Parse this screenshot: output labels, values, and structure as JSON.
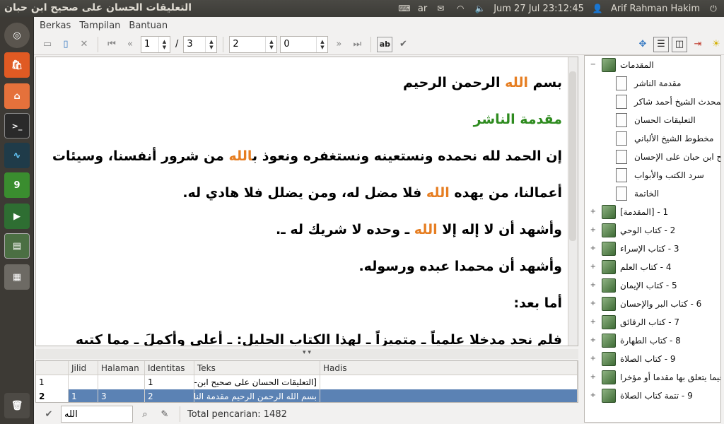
{
  "window_title": "التعليقات الحسان على صحيح ابن حبان",
  "tray": {
    "keyboard": "ar",
    "datetime": "Jum 27 Jul 23:12:45",
    "user": "Arif Rahman Hakim"
  },
  "menu": [
    "Berkas",
    "Tampilan",
    "Bantuan"
  ],
  "toolbar": {
    "volume": "1",
    "volume_total": "3",
    "page": "2",
    "offset": "0"
  },
  "text_lines": [
    {
      "parts": [
        {
          "t": "بسم ",
          "c": ""
        },
        {
          "t": "الله",
          "c": "orange"
        },
        {
          "t": " الرحمن الرحيم",
          "c": ""
        }
      ]
    },
    {
      "parts": [
        {
          "t": "مقدمة الناشر",
          "c": "green"
        }
      ]
    },
    {
      "parts": [
        {
          "t": "إن الحمد لله نحمده ونستعينه ونستغفره ونعوذ ب",
          "c": ""
        },
        {
          "t": "الله",
          "c": "orange"
        },
        {
          "t": " من شرور أنفسنا، وسيئات",
          "c": ""
        }
      ]
    },
    {
      "parts": [
        {
          "t": "أعمالنا، من يهده ",
          "c": ""
        },
        {
          "t": "الله",
          "c": "orange"
        },
        {
          "t": " فلا مضل له، ومن يضلل فلا هادي له.",
          "c": ""
        }
      ]
    },
    {
      "parts": [
        {
          "t": "وأشهد أن لا إله إلا ",
          "c": ""
        },
        {
          "t": "الله",
          "c": "orange"
        },
        {
          "t": " ـ وحده لا شريك له ـ.",
          "c": ""
        }
      ]
    },
    {
      "parts": [
        {
          "t": "وأشهد أن محمدا عبده ورسوله.",
          "c": ""
        }
      ]
    },
    {
      "parts": [
        {
          "t": "أما بعد:",
          "c": ""
        }
      ]
    },
    {
      "parts": [
        {
          "t": "فلم نجد مدخلا علمياً ـ متميزاً ـ لهذا الكتاب الجليل: ـ أعلى وأكملَ ـ مما كتبه",
          "c": ""
        }
      ]
    }
  ],
  "results": {
    "headers": [
      "",
      "Jilid",
      "Halaman",
      "Identitas",
      "Teks",
      "Hadis"
    ],
    "rows": [
      [
        "1",
        "",
        "",
        "1",
        "[التعليقات الحسان على صحيح ابن-",
        ""
      ],
      [
        "2",
        "1",
        "3",
        "2",
        "بسم الله الرحمن الرحيم مقدمة النا",
        ""
      ]
    ]
  },
  "search": {
    "value": "الله",
    "total_label": "Total pencarian: 1482"
  },
  "tree": [
    {
      "label": "المقدمات",
      "type": "book",
      "level": 0,
      "expander": "−"
    },
    {
      "label": "مقدمة الناشر",
      "type": "page",
      "level": 1
    },
    {
      "label": "ترجمة العلامة المحدث الشيخ أحمد شاكر",
      "type": "page",
      "level": 1
    },
    {
      "label": "التعليقات الحسان",
      "type": "page",
      "level": 1
    },
    {
      "label": "مخطوط الشيخ الألباني",
      "type": "page",
      "level": 1
    },
    {
      "label": "الإحسان في تقريب صحيح ابن حبان على الإحسان",
      "type": "page",
      "level": 1
    },
    {
      "label": "سرد الكتب والأبواب",
      "type": "page",
      "level": 1
    },
    {
      "label": "الخاتمة",
      "type": "page",
      "level": 1
    },
    {
      "label": "1 - [المقدمة]",
      "type": "book",
      "level": 0,
      "expander": "+"
    },
    {
      "label": "2 - كتاب الوحي",
      "type": "book",
      "level": 0,
      "expander": "+"
    },
    {
      "label": "3 - كتاب الإسراء",
      "type": "book",
      "level": 0,
      "expander": "+"
    },
    {
      "label": "4 - كتاب العلم",
      "type": "book",
      "level": 0,
      "expander": "+"
    },
    {
      "label": "5 - كتاب الإيمان",
      "type": "book",
      "level": 0,
      "expander": "+"
    },
    {
      "label": "6 - كتاب البر والإحسان",
      "type": "book",
      "level": 0,
      "expander": "+"
    },
    {
      "label": "7 - كتاب الرقائق",
      "type": "book",
      "level": 0,
      "expander": "+"
    },
    {
      "label": "8 - كتاب الطهارة",
      "type": "book",
      "level": 0,
      "expander": "+"
    },
    {
      "label": "9 - كتاب الصلاة",
      "type": "book",
      "level": 0,
      "expander": "+"
    },
    {
      "label": "فصل فيما يتعلق بها مقدما أو مؤخرا",
      "type": "book",
      "level": 0,
      "expander": "+"
    },
    {
      "label": "9 - تتمة كتاب الصلاة",
      "type": "book",
      "level": 0,
      "expander": "+"
    }
  ],
  "colors": {
    "accent_orange": "#e67e22",
    "heading_green": "#2e8b1f",
    "selection": "#5b82b4"
  }
}
